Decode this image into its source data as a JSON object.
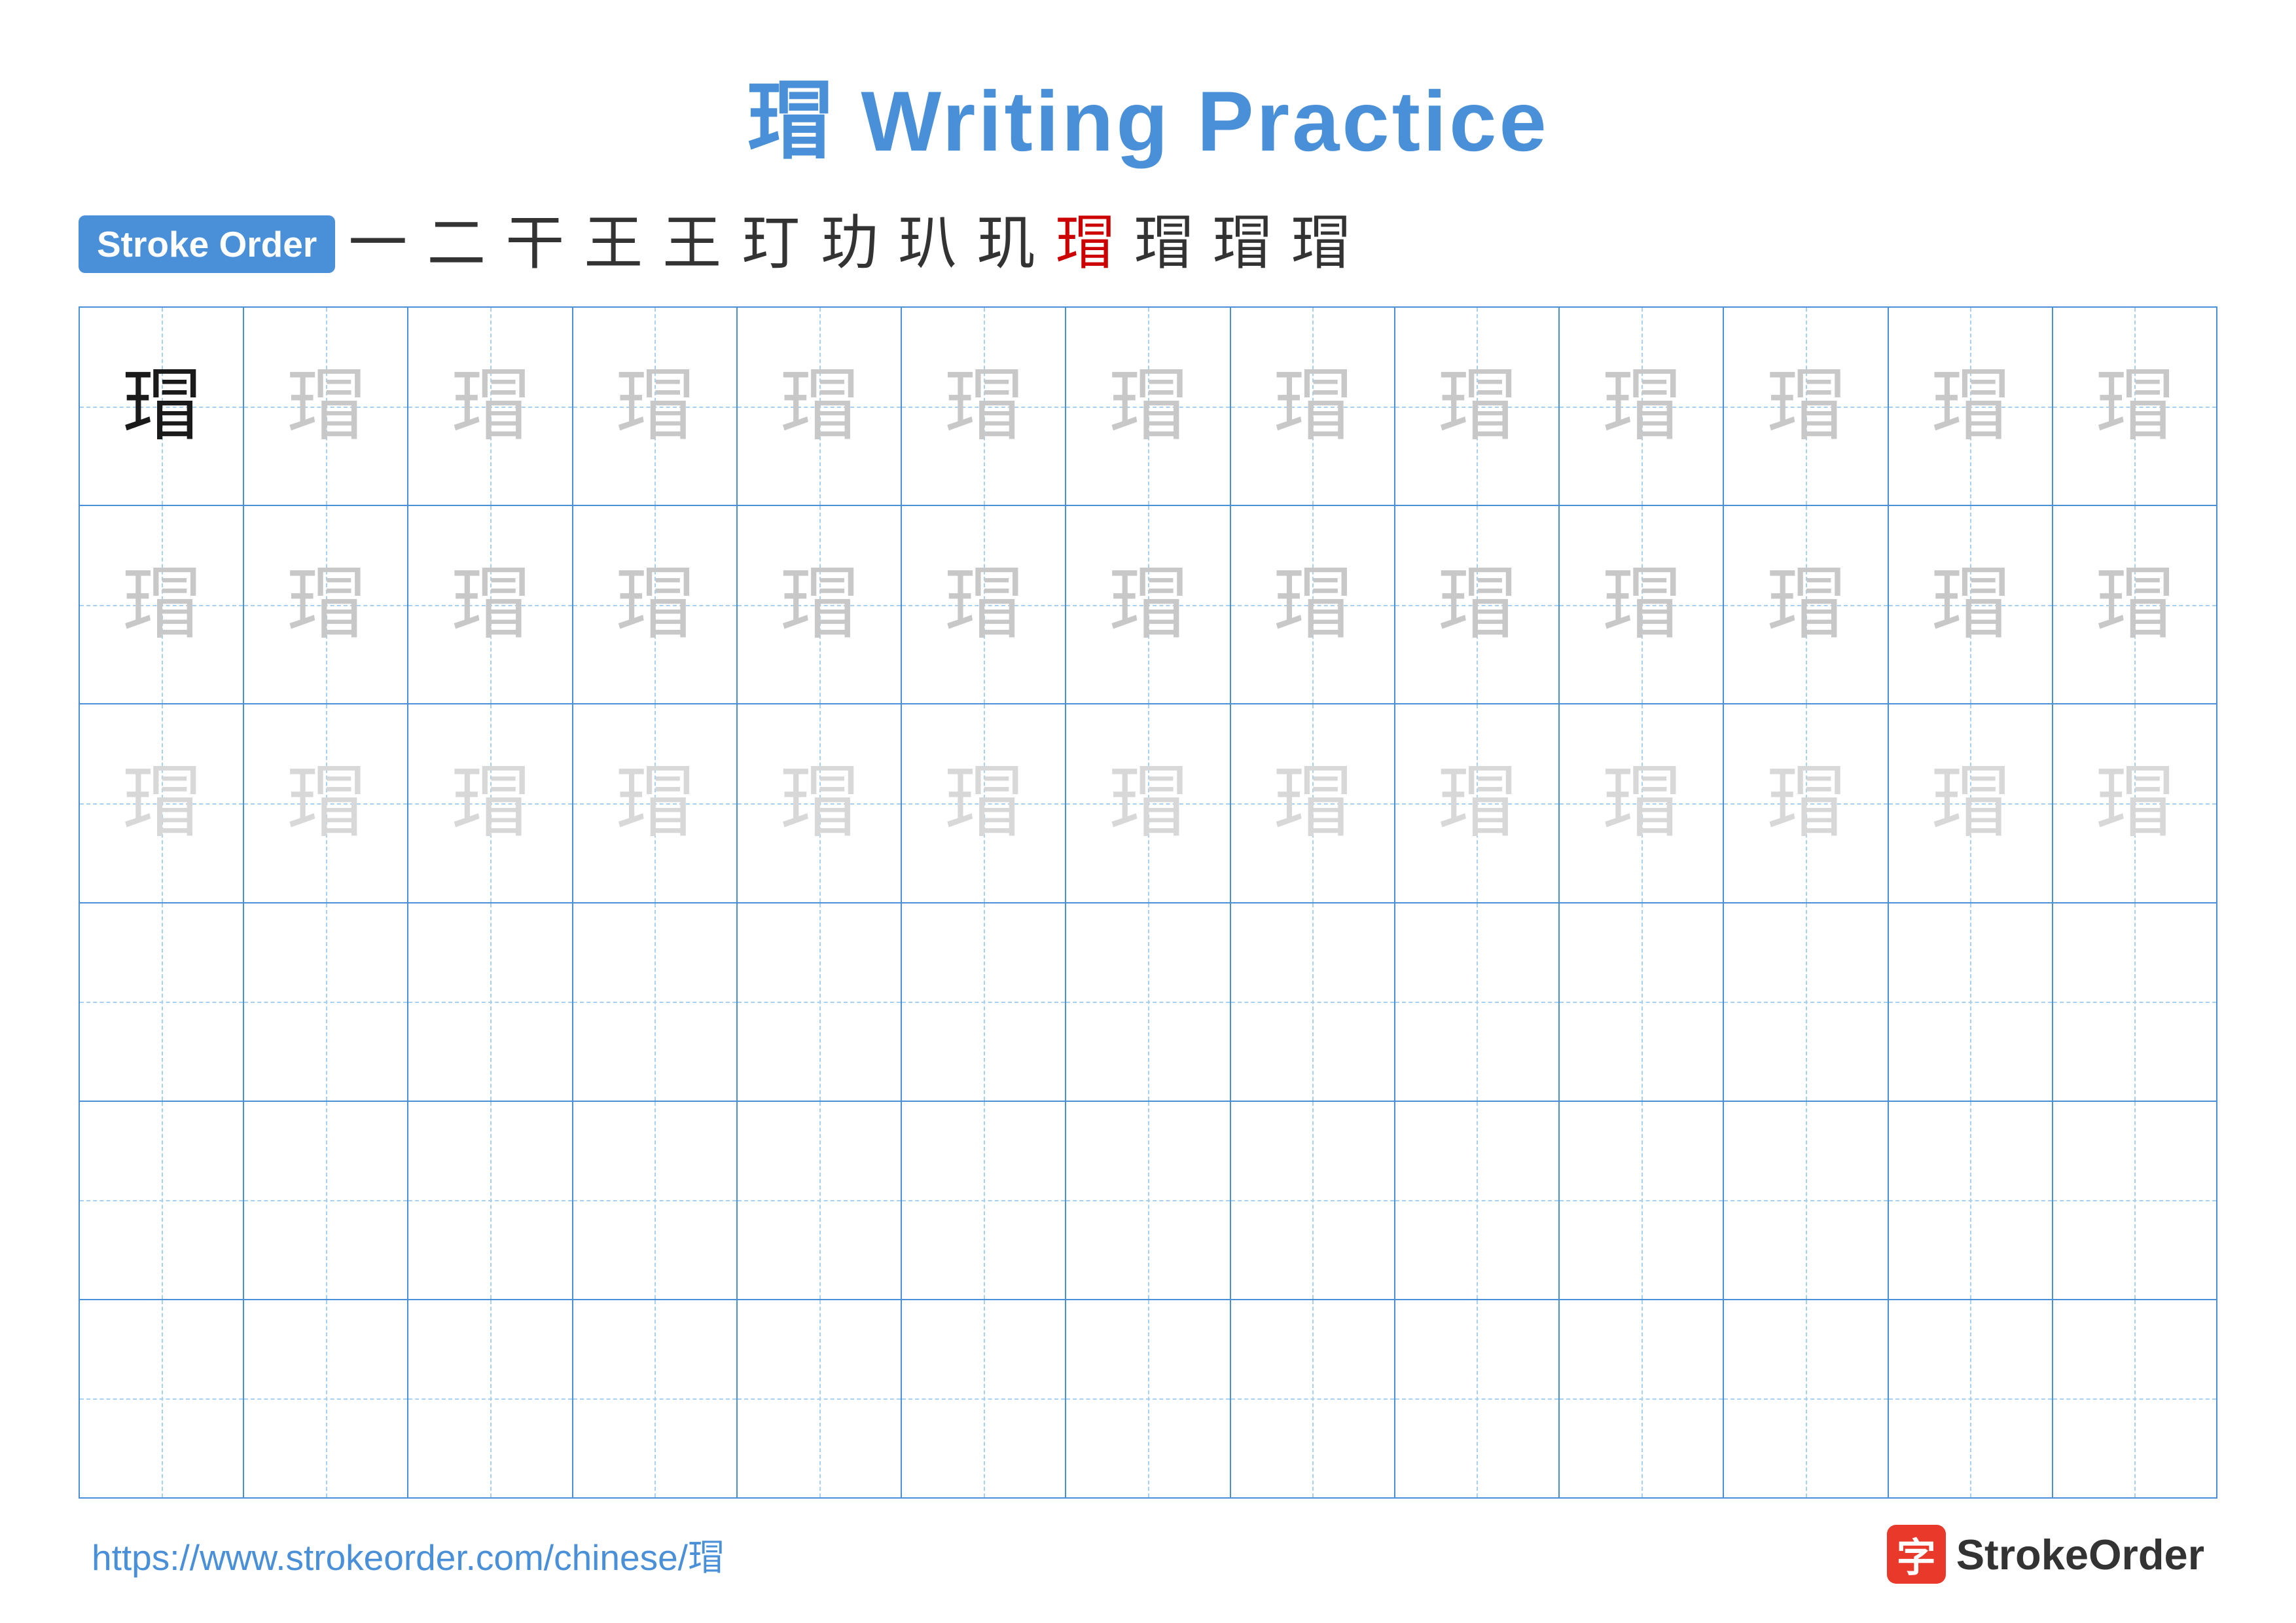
{
  "title": {
    "character": "瑁",
    "label": "Writing Practice"
  },
  "stroke_order": {
    "badge_label": "Stroke Order",
    "strokes": [
      "一",
      "二",
      "干",
      "王",
      "王",
      "玎",
      "玏",
      "玐",
      "玑",
      "瑁",
      "瑁",
      "瑁",
      "瑁"
    ]
  },
  "grid": {
    "rows": 6,
    "cols": 13,
    "character": "瑁",
    "row_types": [
      "solid_then_light1",
      "light1",
      "light2",
      "empty",
      "empty",
      "empty"
    ]
  },
  "footer": {
    "url": "https://www.strokeorder.com/chinese/瑁",
    "logo_char": "字",
    "logo_name": "StrokeOrder"
  }
}
